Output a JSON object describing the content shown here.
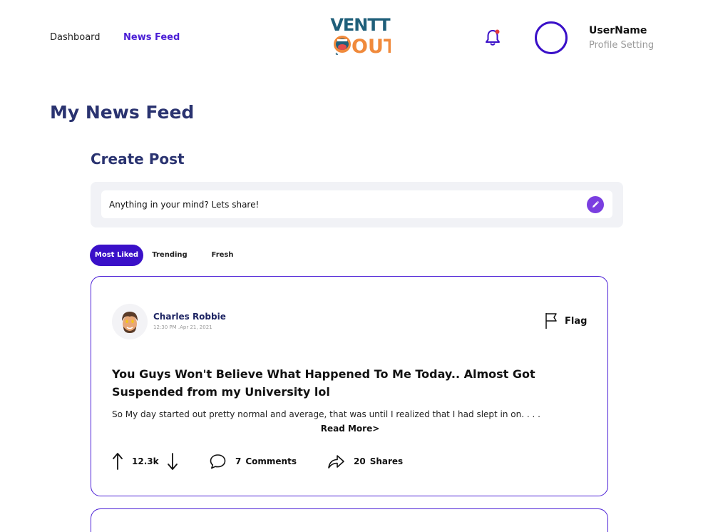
{
  "nav": {
    "dashboard": "Dashboard",
    "news_feed": "News Feed"
  },
  "logo": {
    "line1": "VENTT",
    "line2": "OUT"
  },
  "user": {
    "name": "UserName",
    "profile_setting": "Profile Setting"
  },
  "page": {
    "title": "My News Feed",
    "create_post_title": "Create Post",
    "create_placeholder": "Anything in your mind? Lets share!"
  },
  "filters": {
    "tabs": [
      "Most Liked",
      "Trending",
      "Fresh"
    ],
    "active": "Most Liked"
  },
  "post": {
    "author": "Charles Robbie",
    "time": "12:30 PM .Apr 21, 2021",
    "flag_label": "Flag",
    "title": "You Guys Won't Believe What Happened To Me Today.. Almost Got Suspended from my University lol",
    "excerpt": "So My day started out pretty normal and average, that was until I realized that I had slept in on. . . .",
    "read_more": "Read More>",
    "votes": "12.3k",
    "comments_count": "7",
    "comments_label": "Comments",
    "shares_count": "20",
    "shares_label": "Shares"
  },
  "colors": {
    "accent": "#3a10c8",
    "heading": "#2a3370",
    "pencil": "#7a3ee0",
    "logo_blue": "#1f5f7a",
    "logo_orange": "#f08a3c",
    "notification_dot": "#e63a3a"
  },
  "icons": {
    "bell": "bell-icon",
    "pencil": "pencil-icon",
    "flag": "flag-icon",
    "upvote": "arrow-up-icon",
    "downvote": "arrow-down-icon",
    "comment": "comment-icon",
    "share": "share-icon"
  }
}
